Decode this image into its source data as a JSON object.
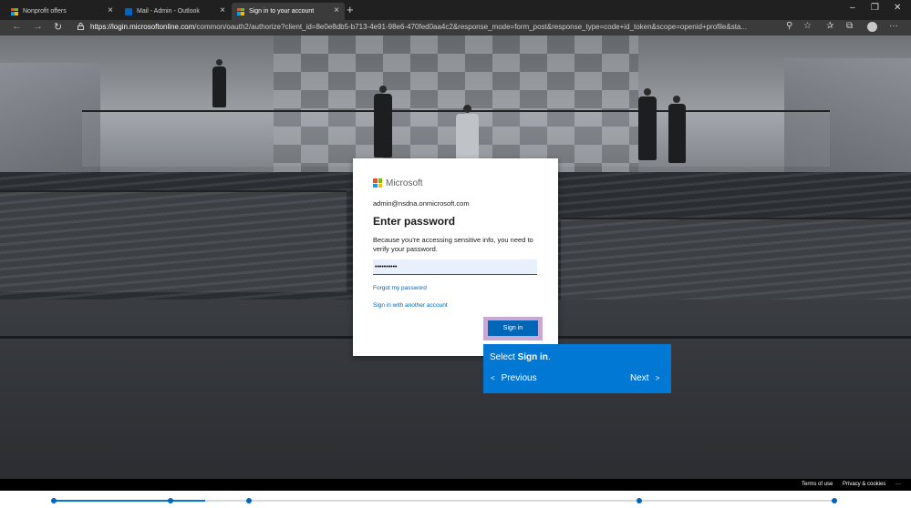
{
  "browser": {
    "tabs": [
      {
        "title": "Nonprofit offers",
        "favicon": "windows-logo-icon"
      },
      {
        "title": "Mail - Admin - Outlook",
        "favicon": "outlook-icon"
      },
      {
        "title": "Sign in to your account",
        "favicon": "microsoft-logo-icon",
        "active": true
      }
    ],
    "close_glyph": "×",
    "new_tab_glyph": "+",
    "window_controls": {
      "minimize": "–",
      "restore": "❐",
      "close": "✕"
    },
    "nav": {
      "back": "←",
      "forward": "→",
      "refresh": "↻"
    },
    "url_host": "https://login.microsoftonline.com",
    "url_rest": "/common/oauth2/authorize?client_id=8e0e8db5-b713-4e91-98e6-470fed0aa4c2&response_mode=form_post&response_type=code+id_token&scope=openid+profile&sta...",
    "toolbar_icons": {
      "search": "⚲",
      "favorite": "☆",
      "favorites": "✰",
      "collections": "⧉",
      "more": "···"
    }
  },
  "signin": {
    "brand": "Microsoft",
    "identity": "admin@nsdna.onmicrosoft.com",
    "heading": "Enter password",
    "description": "Because you're accessing sensitive info, you need to verify your password.",
    "password_value": "••••••••••",
    "forgot_link": "Forgot my password",
    "other_account_link": "Sign in with another account",
    "signin_button": "Sign in"
  },
  "guide": {
    "prefix": "Select ",
    "bold": "Sign in",
    "suffix": ".",
    "previous": "Previous",
    "previous_glyph": "<",
    "next": "Next",
    "next_glyph": ">"
  },
  "footer": {
    "terms": "Terms of use",
    "privacy": "Privacy & cookies",
    "more": "···"
  },
  "timeline": {
    "steps": 5,
    "progress_percent": 19.5
  },
  "colors": {
    "accent": "#0067b8",
    "guide": "#0078d4",
    "highlight": "#c9a8d4"
  }
}
